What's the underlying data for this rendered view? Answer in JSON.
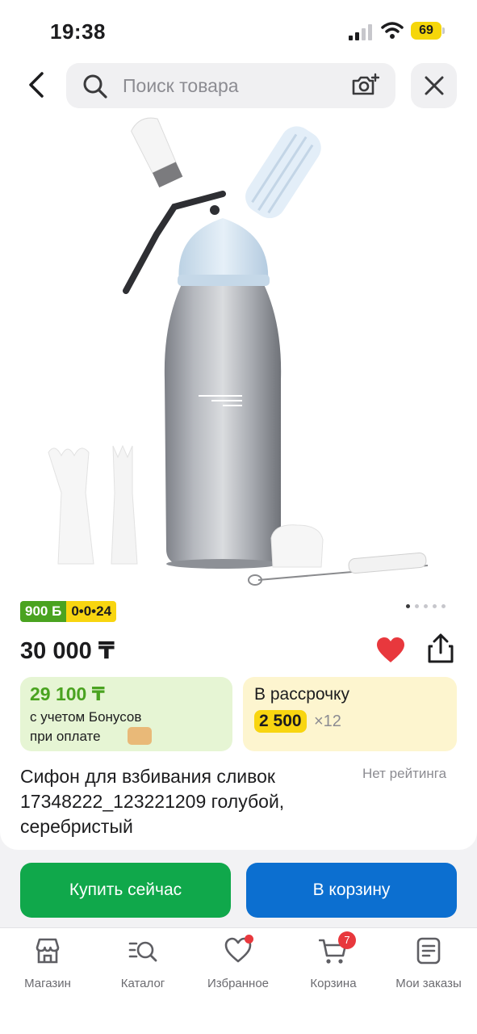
{
  "status_bar": {
    "time": "19:38",
    "battery": "69"
  },
  "search": {
    "placeholder": "Поиск товара"
  },
  "product": {
    "badge_bonus": "900 Б",
    "badge_installment": "0•0•24",
    "price": "30 000 ₸",
    "bonus_price": "29 100 ₸",
    "bonus_line1": "с учетом Бонусов",
    "bonus_line2": "при оплате",
    "installment_title": "В рассрочку",
    "installment_monthly": "2 500",
    "installment_multiplier": "×12",
    "title": "Сифон для взбивания сливок 17348222_123221209 голубой, серебристый",
    "rating": "Нет рейтинга",
    "image_pages": 5,
    "image_current_page": 1
  },
  "actions": {
    "buy_now": "Купить сейчас",
    "add_to_cart": "В корзину"
  },
  "tabbar": {
    "items": [
      {
        "label": "Магазин",
        "icon": "store-icon"
      },
      {
        "label": "Каталог",
        "icon": "catalog-search-icon"
      },
      {
        "label": "Избранное",
        "icon": "heart-outline-icon",
        "dot": true
      },
      {
        "label": "Корзина",
        "icon": "cart-icon",
        "badge": "7"
      },
      {
        "label": "Мои заказы",
        "icon": "orders-icon"
      }
    ]
  },
  "colors": {
    "bonus_green": "#4aa320",
    "installment_yellow": "#f8d510",
    "buy_green": "#10a84b",
    "cart_blue": "#0c6fd0",
    "favorite_red": "#e8383d"
  }
}
